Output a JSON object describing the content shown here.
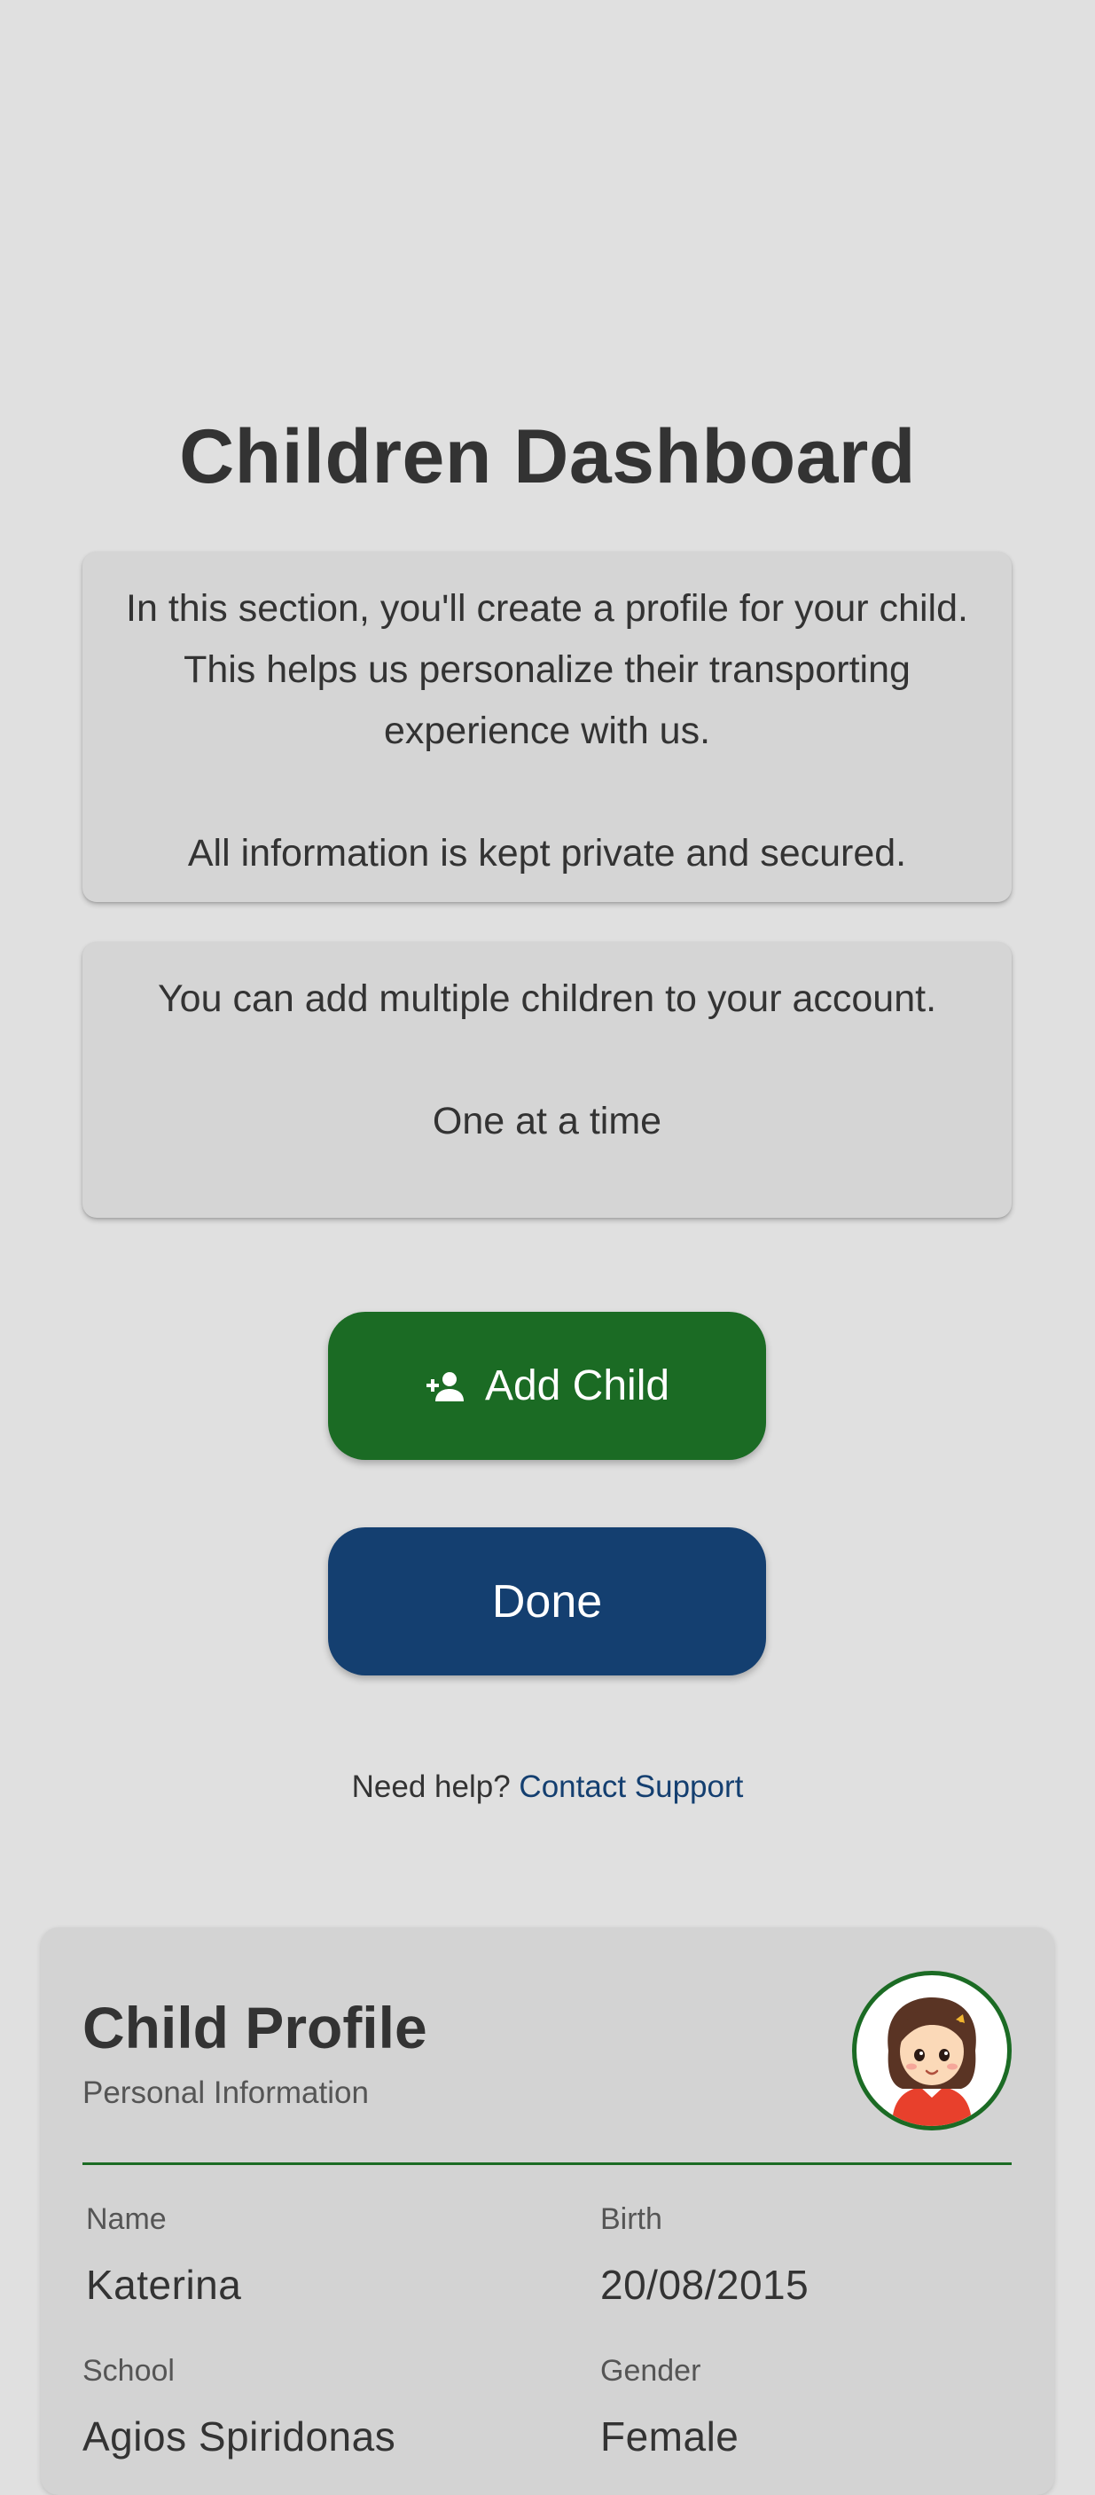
{
  "header": {
    "title": "Children Dashboard"
  },
  "info_cards": [
    {
      "line1": "In this section, you'll create a profile for your child. This helps us personalize their transporting experience with us.",
      "line2": "All information is kept private and secured."
    },
    {
      "line1": "You can add multiple children to your account.",
      "line2": "One at a time"
    }
  ],
  "actions": {
    "add_child_label": "Add Child",
    "add_child_icon": "person-add-icon",
    "done_label": "Done"
  },
  "help": {
    "prompt": "Need help?",
    "link_label": "Contact Support"
  },
  "profile": {
    "title": "Child Profile",
    "subtitle": "Personal Information",
    "avatar_icon": "girl-avatar-icon",
    "fields": [
      {
        "label": "Name",
        "value": "Katerina"
      },
      {
        "label": "Birth",
        "value": "20/08/2015"
      },
      {
        "label": "School",
        "value": "Agios Spiridonas"
      },
      {
        "label": "Gender",
        "value": "Female"
      }
    ]
  },
  "colors": {
    "background": "#e0e0e0",
    "primary_green": "#1b6b24",
    "primary_blue": "#143f70",
    "card_bg": "#d5d5d5",
    "text": "#333333"
  }
}
